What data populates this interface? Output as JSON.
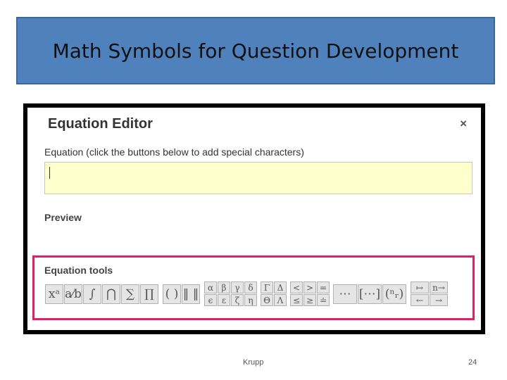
{
  "slide": {
    "title": "Math Symbols for Question Development",
    "footer_author": "Krupp",
    "page_number": "24"
  },
  "dialog": {
    "title": "Equation Editor",
    "close": "×",
    "equation_label": "Equation (click the buttons below to add special characters)",
    "equation_value": "",
    "preview_label": "Preview",
    "tools_label": "Equation tools"
  },
  "tools": {
    "group1": [
      "xᵃ",
      "a⁄b",
      "∫",
      "⋂",
      "∑",
      "∏"
    ],
    "group2": [
      "( )",
      "‖ ‖"
    ],
    "greek_lower": [
      "α",
      "ϵ",
      "β",
      "ε",
      "γ",
      "ζ",
      "δ",
      "η"
    ],
    "greek_upper": [
      "Γ",
      "Θ",
      "Δ",
      "Λ"
    ],
    "relations": [
      "<",
      "≤",
      ">",
      "≥",
      "=",
      "≐"
    ],
    "matrices": [
      "⋯",
      "[⋯]",
      "(ⁿᵣ)"
    ],
    "arrows": [
      "↦",
      "←",
      "n→",
      "→"
    ]
  },
  "colors": {
    "title_band": "#4f81bd",
    "input_bg": "#ffffcc",
    "tools_border": "#e0206a"
  }
}
